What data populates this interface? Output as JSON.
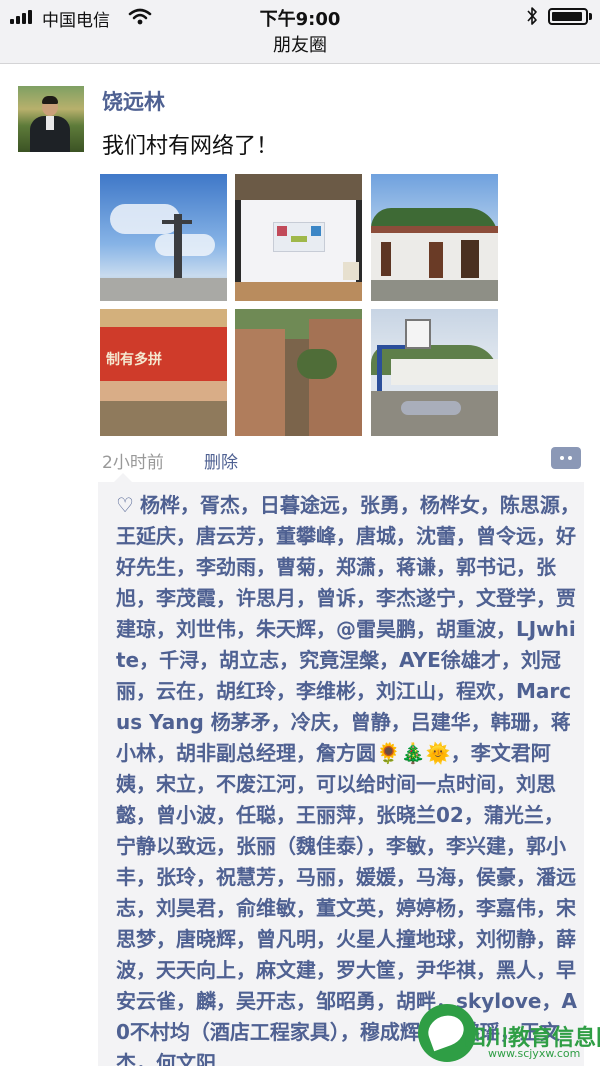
{
  "status_bar": {
    "carrier": "中国电信",
    "time": "下午9:00",
    "battery_level": 0.95
  },
  "nav": {
    "title": "朋友圈"
  },
  "post": {
    "user_name": "饶远林",
    "text": "我们村有网络了！",
    "time": "2小时前",
    "delete_label": "删除",
    "photos": [
      "utility-pole-photo",
      "computer-screen-photo",
      "village-building-photo",
      "red-wall-banner-photo",
      "narrow-alley-photo",
      "basketball-court-photo"
    ],
    "photo_banner_text": "制有多拼"
  },
  "likes": {
    "before_emoji": "杨桦，胥杰，日暮途远，张勇，杨桦女，陈思源，王延庆，唐云芳，董攀峰，唐城，沈蕾，曾令远，好好先生，李劲雨，曹菊，郑潇，蒋谦，郭书记，张旭，李茂霞，许思月，曾诉，李杰遂宁，文登学，贾建琼，刘世伟，朱天辉，@雷昊鹏，胡重波，LJwhite，千浔，胡立志，究竟涅槃，AYE徐雄才，刘冠丽，云在，胡红玲，李维彬，刘江山，程欢，Marcus Yang 杨茅矛，冷庆，曾静，吕建华，韩珊，蒋小林，胡非副总经理，詹方圆",
    "emojis": [
      "🌻",
      "🎄",
      "🌞"
    ],
    "after_emoji": "，李文君阿姨，宋立，不废江河，可以给时间一点时间，刘思懿，曾小波，任聪，王丽萍，张晓兰02，蒲光兰，宁静以致远，张丽（魏佳泰），李敏，李兴建，郭小丰，张玲，祝慧芳，马丽，媛媛，马海，侯豪，潘远志，刘昊君，俞维敏，董文英，婷婷杨，李嘉伟，宋思梦，唐晓辉，曾凡明，火星人撞地球，刘彻静，薛波，天天向上，麻文建，罗大筐，尹华祺，黑人，早安云雀，麟，吴开志，邹昭勇，胡畔，skylove，A0不村均（酒店工程家具），穆成辉，范璐瑶，王文杰，何文阳"
  },
  "watermark": {
    "title": "四川教育信息网",
    "url": "www.scjyxw.com"
  },
  "colors": {
    "link_blue": "#4f6192",
    "likes_bg": "#f3f3f5",
    "watermark_green": "#2f9e45"
  }
}
